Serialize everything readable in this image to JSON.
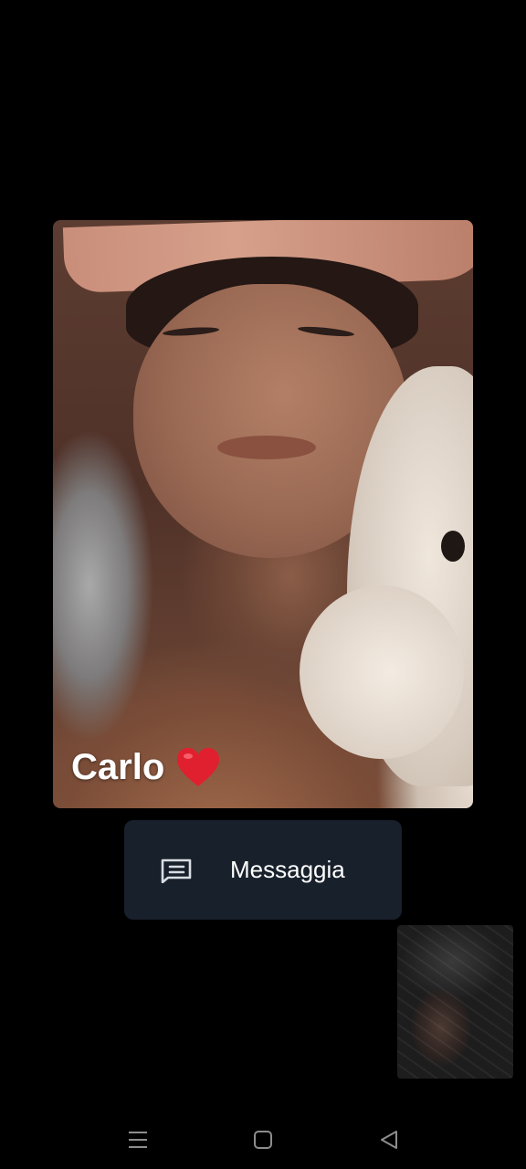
{
  "call": {
    "caller_name": "Carlo",
    "caller_emoji": "heart"
  },
  "actions": {
    "message_label": "Messaggia",
    "message_icon": "message-icon"
  },
  "navigation": {
    "buttons": [
      "menu-icon",
      "home-icon",
      "back-icon"
    ]
  },
  "colors": {
    "background": "#000000",
    "button_background": "#18202b",
    "heart": "#e0202e",
    "nav_icon": "#8d8d8d"
  }
}
